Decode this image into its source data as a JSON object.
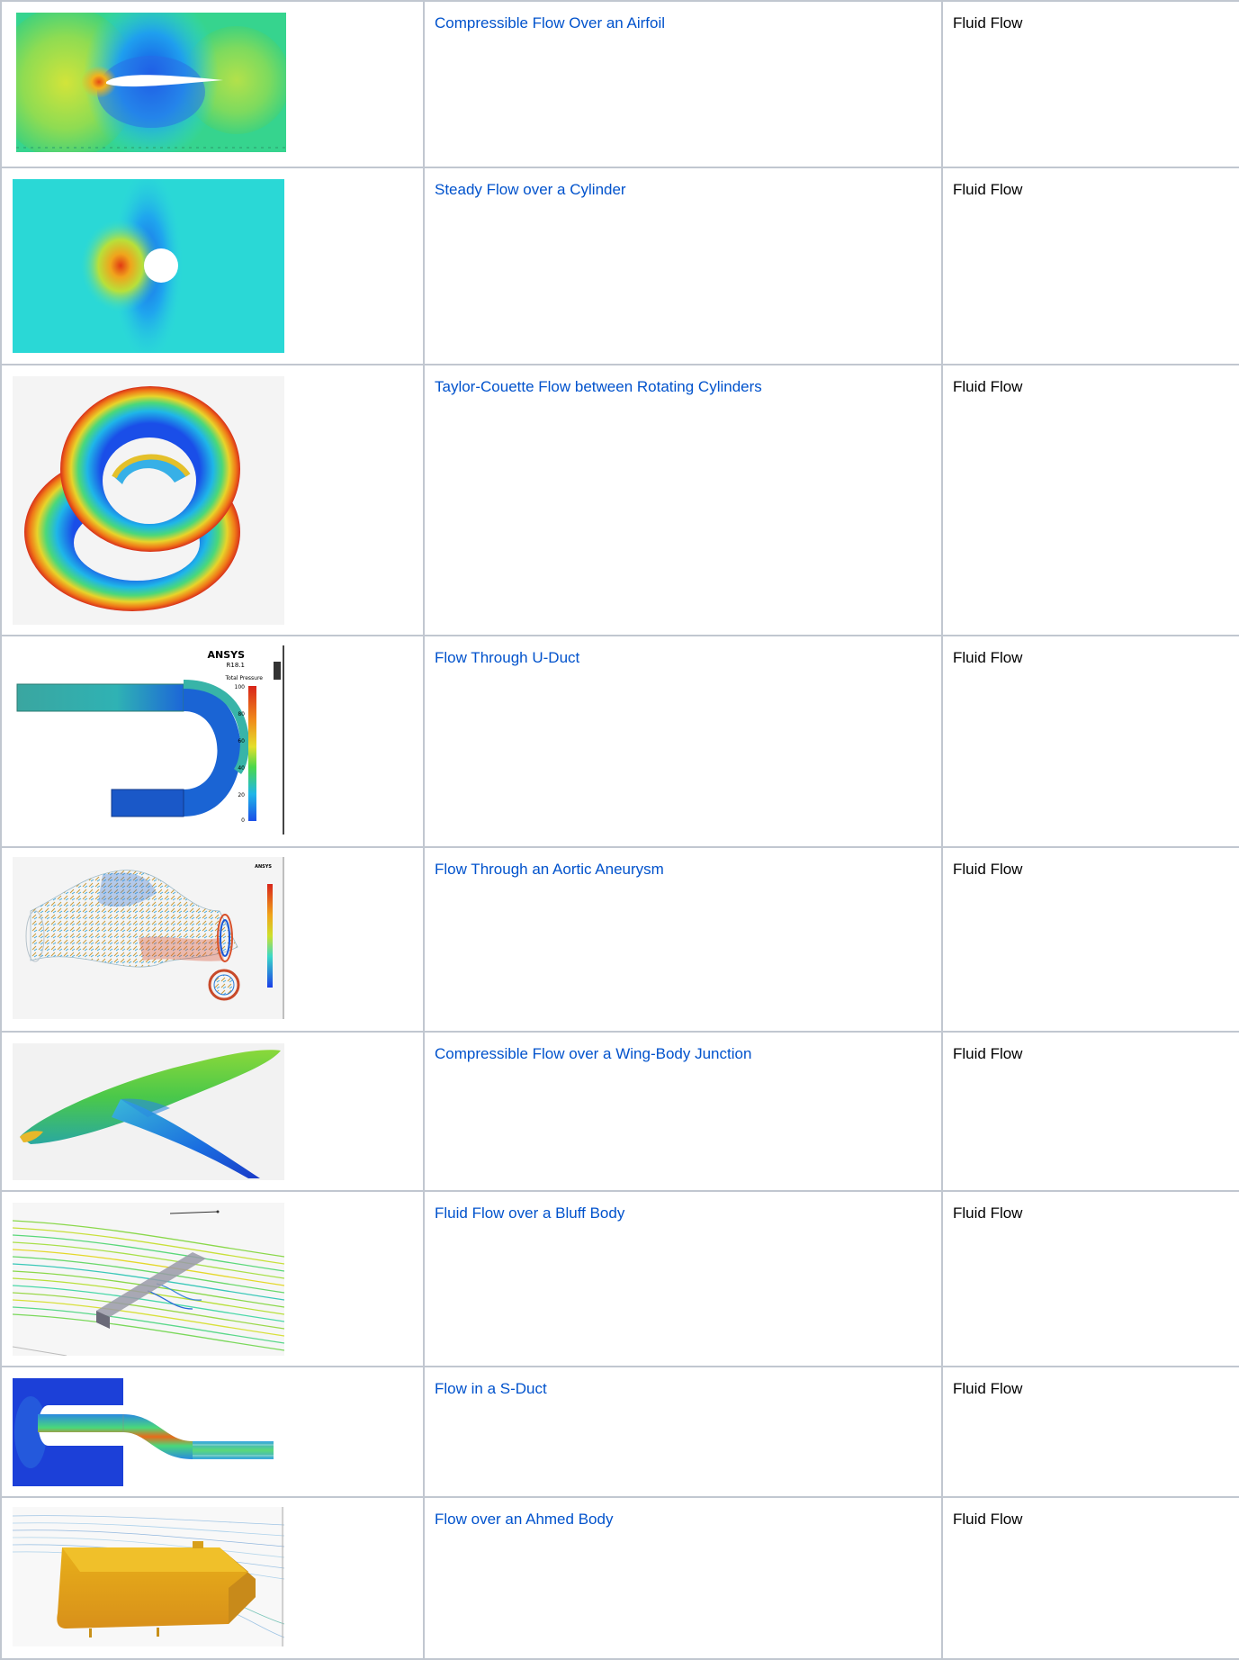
{
  "rows": [
    {
      "title": "Compressible Flow Over an Airfoil",
      "category": "Fluid Flow"
    },
    {
      "title": "Steady Flow over a Cylinder",
      "category": "Fluid Flow"
    },
    {
      "title": "Taylor-Couette Flow between Rotating Cylinders",
      "category": "Fluid Flow"
    },
    {
      "title": "Flow Through U-Duct",
      "category": "Fluid Flow"
    },
    {
      "title": "Flow Through an Aortic Aneurysm",
      "category": "Fluid Flow"
    },
    {
      "title": "Compressible Flow over a Wing-Body Junction",
      "category": "Fluid Flow"
    },
    {
      "title": "Fluid Flow over a Bluff Body",
      "category": "Fluid Flow"
    },
    {
      "title": "Flow in a S-Duct",
      "category": "Fluid Flow"
    },
    {
      "title": "Flow over an Ahmed Body",
      "category": "Fluid Flow"
    }
  ],
  "uduct_legend": {
    "logo": "ANSYS",
    "version": "R18.1",
    "title": "Total Pressure",
    "ticks": [
      "100",
      "80",
      "60",
      "40",
      "20",
      "0"
    ]
  },
  "aortic_logo": "ANSYS",
  "colors": {
    "link": "#0052cc",
    "border": "#c1c7d0"
  }
}
